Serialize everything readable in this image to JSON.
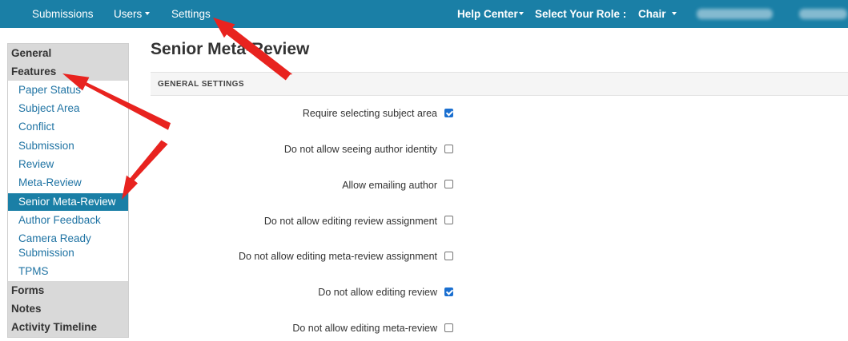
{
  "topnav": {
    "submissions": "Submissions",
    "users": "Users",
    "settings": "Settings",
    "help_center": "Help Center",
    "role_label": "Select Your Role :",
    "role_value": "Chair"
  },
  "sidebar": {
    "general": "General",
    "features": "Features",
    "items": [
      "Paper Status",
      "Subject Area",
      "Conflict",
      "Submission",
      "Review",
      "Meta-Review",
      "Senior Meta-Review",
      "Author Feedback",
      "Camera Ready Submission",
      "TPMS"
    ],
    "active": "Senior Meta-Review",
    "forms": "Forms",
    "notes": "Notes",
    "activity_timeline": "Activity Timeline"
  },
  "main": {
    "title": "Senior Meta-Review",
    "section": "GENERAL SETTINGS",
    "settings": [
      {
        "label": "Require selecting subject area",
        "checked": true
      },
      {
        "label": "Do not allow seeing author identity",
        "checked": false
      },
      {
        "label": "Allow emailing author",
        "checked": false
      },
      {
        "label": "Do not allow editing review assignment",
        "checked": false
      },
      {
        "label": "Do not allow editing meta-review assignment",
        "checked": false
      },
      {
        "label": "Do not allow editing review",
        "checked": true
      },
      {
        "label": "Do not allow editing meta-review",
        "checked": false
      }
    ]
  },
  "colors": {
    "nav": "#1a7fa6",
    "link": "#1f73a3",
    "annotation": "#e8231f"
  }
}
